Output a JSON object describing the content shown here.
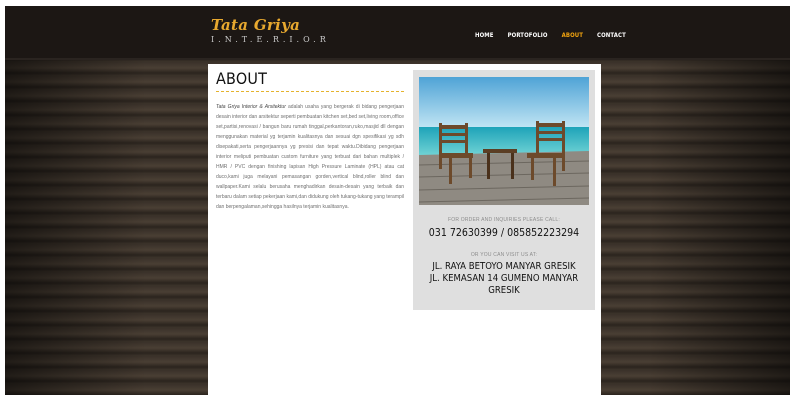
{
  "brand": {
    "title": "Tata Griya",
    "subtitle": "I.N.T.E.R.I.O.R"
  },
  "nav": [
    {
      "label": "HOME",
      "active": false
    },
    {
      "label": "PORTOFOLIO",
      "active": false
    },
    {
      "label": "ABOUT",
      "active": true
    },
    {
      "label": "CONTACT",
      "active": false
    }
  ],
  "page": {
    "title": "ABOUT",
    "intro_emphasis": "Tata Griya Interior & Arsitektur",
    "intro_body": " adalah usaha yang bergerak di bidang pengerjaan desain interior dan arsitektur seperti pembuatan kitchen set,bed set,living room,office set,partisi,renovasi / bangun baru rumah tinggal,perkantoran,ruko,masjid dll dengan menggunakan material yg terjamin kualitasnya dan sesuai dgn spesifikasi yg sdh disepakati,serta pengerjaannya yg presisi dan tepat waktu.Dibidang pengerjaan interior meliputi pembuatan custom furniture yang terbuat dari bahan multiplek / HMR / PVC dengan finishing lapisan High Pressure Laminate (HPL) atau cat duco,kami juga melayani pemasangan gorden,vertical blind,roller blind dan wallpaper.Kami selalu berusaha menghadirkan desain-desain yang terbaik dan terbaru dalam setiap pekerjaan kami,dan didukung oleh tukang-tukang yang terampil dan berpengalaman,sehingga hasilnya terjamin kualitasnya."
  },
  "sidebar": {
    "order_caption": "FOR ORDER AND INQUIRIES PLEASE CALL:",
    "phones": "031 72630399 / 085852223294",
    "visit_caption": "OR YOU CAN VISIT US AT:",
    "address_line1": "JL. RAYA BETOYO MANYAR GRESIK",
    "address_line2": "JL. KEMASAN 14 GUMENO MANYAR",
    "address_line3": "GRESIK"
  },
  "colors": {
    "accent": "#e8a92f",
    "nav_active": "#f2a40f",
    "header_bg": "#1c1714",
    "panel_bg": "#dfdfdf"
  }
}
